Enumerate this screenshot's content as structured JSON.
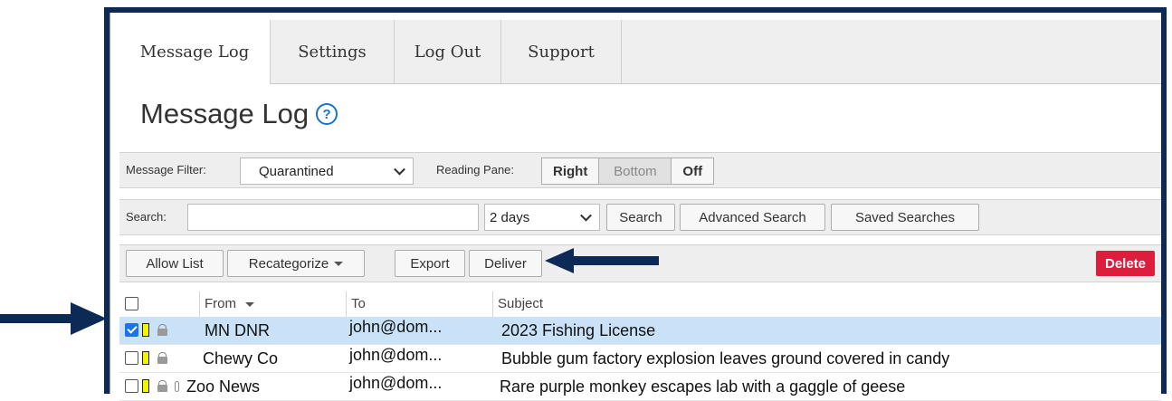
{
  "tabs": [
    {
      "label": "Message Log"
    },
    {
      "label": "Settings"
    },
    {
      "label": "Log Out"
    },
    {
      "label": "Support"
    }
  ],
  "page_title": "Message Log",
  "help_icon": "?",
  "filter": {
    "label": "Message Filter:",
    "value": "Quarantined",
    "reading_pane_label": "Reading Pane:",
    "reading_pane_options": [
      "Right",
      "Bottom",
      "Off"
    ],
    "reading_pane_selected": "Bottom"
  },
  "search": {
    "label": "Search:",
    "value": "",
    "range": "2 days",
    "search_button": "Search",
    "advanced_button": "Advanced Search",
    "saved_button": "Saved Searches"
  },
  "actions": {
    "allow_list": "Allow List",
    "recategorize": "Recategorize",
    "export": "Export",
    "deliver": "Deliver",
    "delete": "Delete"
  },
  "columns": {
    "from": "From",
    "to": "To",
    "subject": "Subject"
  },
  "rows": [
    {
      "from": "MN DNR",
      "to": "john@dom...",
      "subject": "2023 Fishing License",
      "checked": true,
      "attachment": false
    },
    {
      "from": "Chewy Co",
      "to": "john@dom...",
      "subject": "Bubble gum factory explosion leaves ground covered in candy",
      "checked": false,
      "attachment": false
    },
    {
      "from": "Zoo News",
      "to": "john@dom...",
      "subject": "Rare purple monkey escapes lab with a gaggle of geese",
      "checked": false,
      "attachment": true
    }
  ],
  "colors": {
    "frame": "#0d2a57",
    "arrow": "#0d2a57",
    "delete": "#dc1e3c",
    "selected_row": "#c9e2f7",
    "flag": "#f4f400",
    "checkbox": "#1a73e8"
  }
}
